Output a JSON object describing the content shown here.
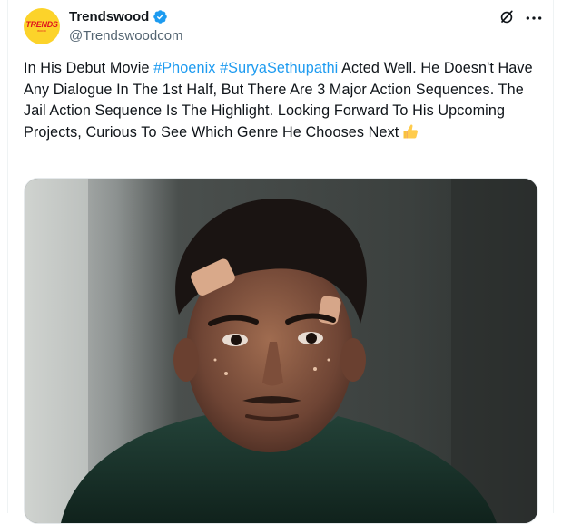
{
  "author": {
    "display_name": "Trendswood",
    "handle": "@Trendswoodcom",
    "avatar_text": "TRENDS",
    "avatar_subtext": "WOOD",
    "verified_icon": "verified-badge-icon",
    "brand_color": "#fcd32a"
  },
  "header_actions": {
    "grok_icon": "grok-icon",
    "more_icon": "more-icon"
  },
  "tweet": {
    "text_part1": "In His Debut Movie ",
    "hashtag1": "#Phoenix",
    "text_space": " ",
    "hashtag2": "#SuryaSethupathi",
    "text_part2": " Acted Well. He Doesn't Have Any Dialogue In The 1st Half, But There Are 3 Major Action Sequences. The Jail Action Sequence Is The Highlight. Looking Forward To His Upcoming Projects, Curious To See Which Genre He Chooses Next",
    "emoji": "thumbs-up-icon",
    "hashtag_color": "#1d9bf0"
  },
  "media": {
    "alt": "photo"
  }
}
